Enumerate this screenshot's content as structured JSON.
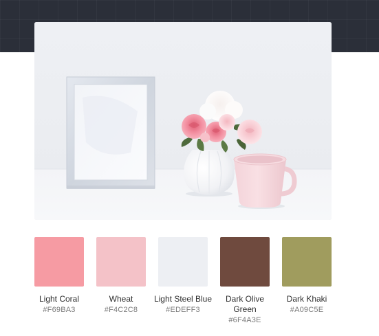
{
  "header": {
    "background_color": "#2b2f39"
  },
  "photo": {
    "subject": "white-photo-frame-pink-roses-vase-pink-mug"
  },
  "palette": {
    "swatches": [
      {
        "name": "Light Coral",
        "hex": "#F69BA3",
        "color": "#F69BA3"
      },
      {
        "name": "Wheat",
        "hex": "#F4C2C8",
        "color": "#F4C2C8"
      },
      {
        "name": "Light Steel Blue",
        "hex": "#EDEFF3",
        "color": "#EDEFF3"
      },
      {
        "name": "Dark Olive Green",
        "hex": "#6F4A3E",
        "color": "#6F4A3E"
      },
      {
        "name": "Dark Khaki",
        "hex": "#A09C5E",
        "color": "#A09C5E"
      }
    ]
  }
}
